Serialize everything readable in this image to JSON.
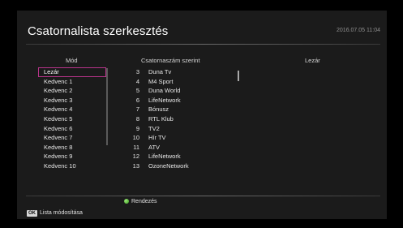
{
  "header": {
    "title": "Csatornalista szerkesztés",
    "datetime": "2016.07.05 11:04"
  },
  "columns": {
    "mode": "Mód",
    "order": "Csatornaszám szerint",
    "lock": "Lezár"
  },
  "modes": [
    "Lezár",
    "Kedvenc 1",
    "Kedvenc 2",
    "Kedvenc 3",
    "Kedvenc 4",
    "Kedvenc 5",
    "Kedvenc 6",
    "Kedvenc 7",
    "Kedvenc 8",
    "Kedvenc 9",
    "Kedvenc 10"
  ],
  "selected_mode": "Lezár",
  "channels": [
    {
      "num": "3",
      "name": "Duna Tv"
    },
    {
      "num": "4",
      "name": "M4 Sport"
    },
    {
      "num": "5",
      "name": "Duna World"
    },
    {
      "num": "6",
      "name": "LifeNetwork"
    },
    {
      "num": "7",
      "name": "Bónusz"
    },
    {
      "num": "8",
      "name": "RTL Klub"
    },
    {
      "num": "9",
      "name": "TV2"
    },
    {
      "num": "10",
      "name": "Hír TV"
    },
    {
      "num": "11",
      "name": "ATV"
    },
    {
      "num": "12",
      "name": "LifeNetwork"
    },
    {
      "num": "13",
      "name": "OzoneNetwork"
    }
  ],
  "footer": {
    "sort_label": "Rendezés",
    "ok_key": "OK",
    "ok_label": "Lista módosítása"
  },
  "colors": {
    "selection_border": "#b8338a",
    "sort_button": "#3aa11f"
  }
}
